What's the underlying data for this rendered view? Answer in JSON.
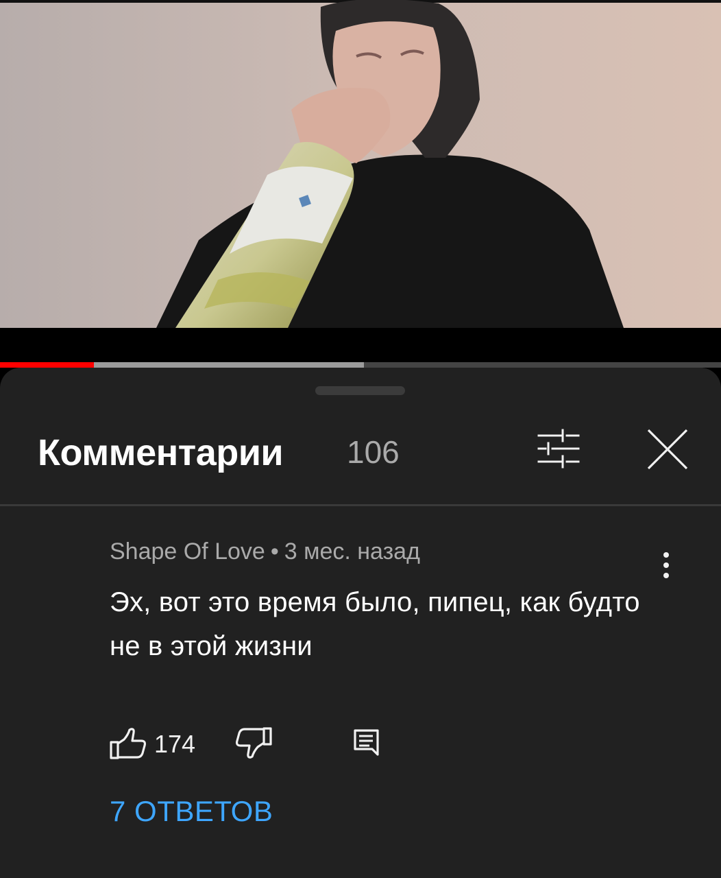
{
  "video": {
    "progress_played": 0.13,
    "progress_buffered": 0.505,
    "colors": {
      "played": "#ff0000",
      "buffered": "#9b9b9b"
    }
  },
  "comments_panel": {
    "title": "Комментарии",
    "count": "106",
    "icons": {
      "filter": "tune-icon",
      "close": "close-icon"
    }
  },
  "comment": {
    "author": "Shape Of Love",
    "separator": "•",
    "time": "3 мес. назад",
    "text": "Эх, вот это время было,  пипец, как будто не в этой жизни",
    "likes": "174",
    "replies_label": "7 ОТВЕТОВ",
    "icons": {
      "like": "thumb-up-icon",
      "dislike": "thumb-down-icon",
      "reply": "reply-icon",
      "menu": "more-vert-icon"
    },
    "link_color": "#3ea6ff"
  }
}
